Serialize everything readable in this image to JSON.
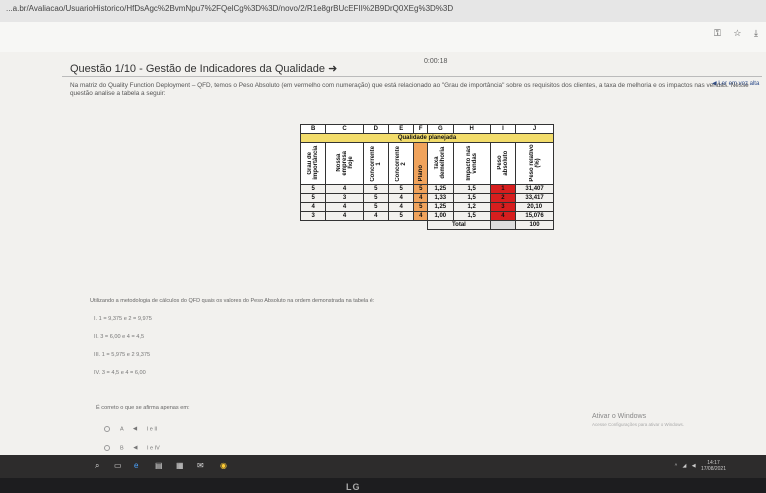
{
  "browser": {
    "url": "...a.br/Avaliacao/UsuarioHistorico/HfDsAgc%2BvmNpu7%2FQelCg%3D%3D/novo/2/R1e8grBUcEFII%2B9DrQ0XEg%3D%3D",
    "icons": [
      "key-icon",
      "star-icon",
      "download-icon"
    ]
  },
  "question": {
    "title": "Questão 1/10 - Gestão de Indicadores da Qualidade",
    "timer": "0:00:18",
    "read_link": "Ler em voz alta",
    "paragraph": "Na matriz do Quality Function Deployment – QFD, temos o Peso Absoluto (em vermelho com numeração) que está relacionado ao \"Grau de importância\" sobre os requisitos dos clientes, a taxa de melhoria e os impactos nas vendas. Nesse questão analise a tabela a seguir:"
  },
  "table": {
    "letters": [
      "B",
      "C",
      "D",
      "E",
      "F",
      "G",
      "H",
      "I",
      "J"
    ],
    "header": "Qualidade planejada",
    "columns": [
      "Grau de importância",
      "Nossa empresa hoje",
      "Concorrente 1",
      "Concorrente 2",
      "Plano",
      "Taxa demelhoria",
      "Impacto nas vendas",
      "Peso absoluto",
      "Peso relativo (%)"
    ],
    "rows": [
      [
        "5",
        "4",
        "5",
        "5",
        "5",
        "1,25",
        "1,5",
        "1",
        "31,407"
      ],
      [
        "5",
        "3",
        "5",
        "4",
        "4",
        "1,33",
        "1,5",
        "2",
        "33,417"
      ],
      [
        "4",
        "4",
        "5",
        "4",
        "5",
        "1,25",
        "1,2",
        "3",
        "20,10"
      ],
      [
        "3",
        "4",
        "4",
        "5",
        "4",
        "1,00",
        "1,5",
        "4",
        "15,076"
      ]
    ],
    "total_label": "Total",
    "total_value": "100"
  },
  "instructions": "Utilizando a metodologia de cálculos do QFD quais os valores do Peso Absoluto na ordem demonstrada na tabela é:",
  "options": [
    "I. 1 = 9,375 e 2 = 9,975",
    "II. 3 = 6,00 e 4 = 4,5",
    "III. 1 = 5,975 e 2 9,375",
    "IV. 3 = 4,5 e 4 = 6,00"
  ],
  "question_line": "É correto o que se afirma apenas em:",
  "answers": [
    {
      "letter": "A",
      "text": "I e II"
    },
    {
      "letter": "B",
      "text": "I e IV"
    }
  ],
  "windows": {
    "activate": "Ativar o Windows",
    "activate_sub": "Acesse Configurações para ativar o Windows.",
    "clock": "14:17",
    "date": "17/08/2021"
  },
  "brand": "LG"
}
